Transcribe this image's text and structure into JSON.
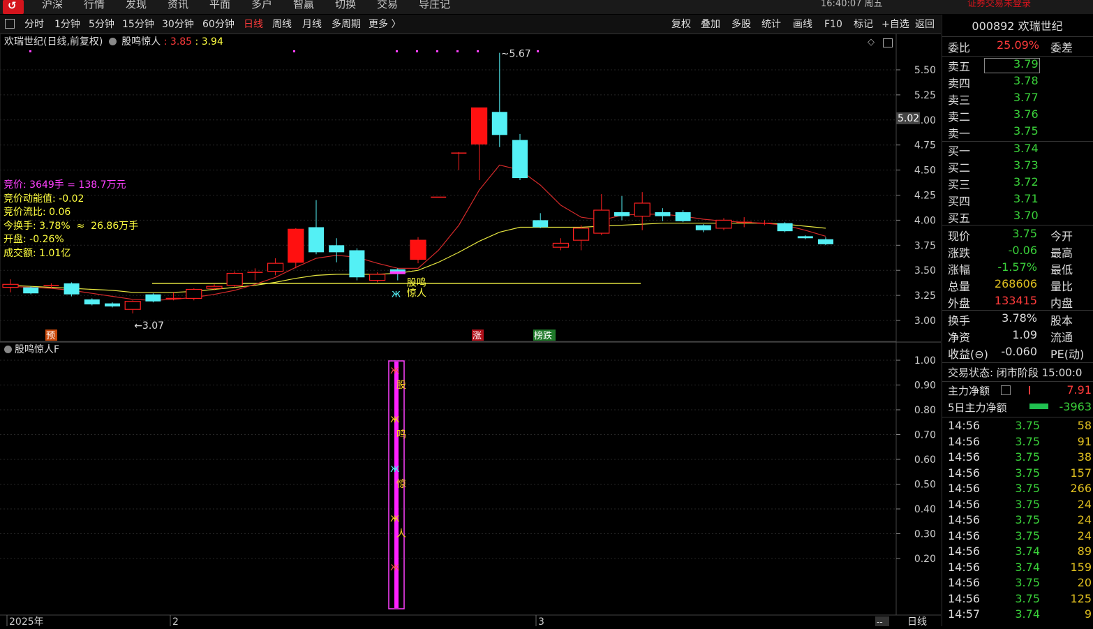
{
  "topbar": {
    "menu": [
      "沪深",
      "行情",
      "发现",
      "资讯",
      "平面",
      "多户",
      "智赢",
      "切换",
      "交易",
      "导庄记"
    ],
    "clock": "16:40:07 周五",
    "login": "证券交易未登录"
  },
  "toolbar": {
    "periods": [
      "分时",
      "1分钟",
      "5分钟",
      "15分钟",
      "30分钟",
      "60分钟",
      "日线",
      "周线",
      "月线",
      "多周期",
      "更多 〉"
    ],
    "active": "日线",
    "right": [
      "复权",
      "叠加",
      "多股",
      "统计",
      "画线",
      "F10",
      "标记",
      "+自选",
      "返回"
    ]
  },
  "main_chart": {
    "title": "欢瑞世纪(日线,前复权)",
    "indicator": "股鸣惊人",
    "val1": "3.85",
    "val2": "3.94",
    "high_label": "5.67",
    "low_label": "3.07",
    "right_price_tag": "5.02",
    "signal_text1": "股鸣",
    "signal_text2": "惊人",
    "badges": [
      {
        "text": "预",
        "color": "#c8480a"
      },
      {
        "text": "涨",
        "color": "#b0101a"
      },
      {
        "text": "榜跌",
        "color": "#1f7a2a"
      }
    ]
  },
  "info_lines": [
    {
      "text": "竞价: 3649手 = 138.7万元",
      "color": "#ff40ff"
    },
    {
      "text": "竞价动能值: -0.02",
      "color": "#ffff40"
    },
    {
      "text": "竞价流比: 0.06",
      "color": "#ffff40"
    },
    {
      "text": "今换手: 3.78%  ≈  26.86万手",
      "color": "#ffff40"
    },
    {
      "text": "开盘: -0.26%",
      "color": "#ffff40"
    },
    {
      "text": "成交额: 1.01亿",
      "color": "#ffff40"
    }
  ],
  "chart_data": {
    "type": "candlestick",
    "ylim": [
      2.9,
      5.75
    ],
    "yticks": [
      "5.50",
      "5.25",
      "5.00",
      "4.75",
      "4.50",
      "4.25",
      "4.00",
      "3.75",
      "3.50",
      "3.25",
      "3.00"
    ],
    "xlabels": [
      "2025年",
      "2",
      "3"
    ],
    "period": "日线",
    "candles": [
      {
        "o": 3.33,
        "c": 3.36,
        "h": 3.41,
        "l": 3.28
      },
      {
        "o": 3.33,
        "c": 3.27,
        "h": 3.34,
        "l": 3.26
      },
      {
        "o": 3.35,
        "c": 3.35,
        "h": 3.37,
        "l": 3.32
      },
      {
        "o": 3.37,
        "c": 3.26,
        "h": 3.38,
        "l": 3.24
      },
      {
        "o": 3.21,
        "c": 3.16,
        "h": 3.22,
        "l": 3.15
      },
      {
        "o": 3.17,
        "c": 3.14,
        "h": 3.18,
        "l": 3.13
      },
      {
        "o": 3.11,
        "c": 3.19,
        "h": 3.2,
        "l": 3.07
      },
      {
        "o": 3.26,
        "c": 3.19,
        "h": 3.27,
        "l": 3.18
      },
      {
        "o": 3.22,
        "c": 3.22,
        "h": 3.28,
        "l": 3.2
      },
      {
        "o": 3.22,
        "c": 3.31,
        "h": 3.32,
        "l": 3.2
      },
      {
        "o": 3.32,
        "c": 3.34,
        "h": 3.36,
        "l": 3.3
      },
      {
        "o": 3.35,
        "c": 3.47,
        "h": 3.49,
        "l": 3.33
      },
      {
        "o": 3.48,
        "c": 3.48,
        "h": 3.52,
        "l": 3.4
      },
      {
        "o": 3.49,
        "c": 3.57,
        "h": 3.62,
        "l": 3.45
      },
      {
        "o": 3.58,
        "c": 3.91,
        "h": 3.92,
        "l": 3.52
      },
      {
        "o": 3.93,
        "c": 3.68,
        "h": 4.2,
        "l": 3.66
      },
      {
        "o": 3.75,
        "c": 3.68,
        "h": 3.82,
        "l": 3.58
      },
      {
        "o": 3.7,
        "c": 3.43,
        "h": 3.72,
        "l": 3.4
      },
      {
        "o": 3.4,
        "c": 3.46,
        "h": 3.48,
        "l": 3.38
      },
      {
        "o": 3.51,
        "c": 3.47,
        "h": 3.52,
        "l": 3.4
      },
      {
        "o": 3.61,
        "c": 3.8,
        "h": 3.83,
        "l": 3.57
      },
      {
        "o": 4.23,
        "c": 4.23,
        "h": 4.23,
        "l": 4.23
      },
      {
        "o": 4.67,
        "c": 4.67,
        "h": 4.68,
        "l": 4.5
      },
      {
        "o": 4.76,
        "c": 5.12,
        "h": 5.12,
        "l": 4.4
      },
      {
        "o": 5.08,
        "c": 4.85,
        "h": 5.67,
        "l": 4.73
      },
      {
        "o": 4.8,
        "c": 4.42,
        "h": 4.86,
        "l": 4.4
      },
      {
        "o": 4.0,
        "c": 3.93,
        "h": 4.07,
        "l": 3.92
      },
      {
        "o": 3.73,
        "c": 3.77,
        "h": 3.82,
        "l": 3.7
      },
      {
        "o": 3.8,
        "c": 3.92,
        "h": 3.95,
        "l": 3.7
      },
      {
        "o": 3.87,
        "c": 4.1,
        "h": 4.26,
        "l": 3.85
      },
      {
        "o": 4.08,
        "c": 4.04,
        "h": 4.24,
        "l": 4.0
      },
      {
        "o": 4.04,
        "c": 4.17,
        "h": 4.28,
        "l": 3.9
      },
      {
        "o": 4.08,
        "c": 4.04,
        "h": 4.12,
        "l": 3.99
      },
      {
        "o": 4.08,
        "c": 3.99,
        "h": 4.1,
        "l": 3.98
      },
      {
        "o": 3.95,
        "c": 3.9,
        "h": 3.96,
        "l": 3.88
      },
      {
        "o": 3.92,
        "c": 4.0,
        "h": 4.02,
        "l": 3.9
      },
      {
        "o": 3.98,
        "c": 3.98,
        "h": 4.03,
        "l": 3.93
      },
      {
        "o": 3.97,
        "c": 3.97,
        "h": 4.0,
        "l": 3.95
      },
      {
        "o": 3.97,
        "c": 3.89,
        "h": 3.98,
        "l": 3.88
      },
      {
        "o": 3.84,
        "c": 3.82,
        "h": 3.85,
        "l": 3.81
      },
      {
        "o": 3.81,
        "c": 3.76,
        "h": 3.83,
        "l": 3.75
      }
    ],
    "ma_red": [
      3.34,
      3.33,
      3.32,
      3.3,
      3.27,
      3.24,
      3.21,
      3.2,
      3.21,
      3.23,
      3.26,
      3.3,
      3.36,
      3.43,
      3.53,
      3.62,
      3.65,
      3.63,
      3.57,
      3.52,
      3.52,
      3.7,
      3.95,
      4.3,
      4.55,
      4.5,
      4.35,
      4.15,
      4.03,
      4.0,
      4.05,
      4.06,
      4.06,
      4.04,
      4.01,
      3.99,
      3.98,
      3.97,
      3.95,
      3.9,
      3.84
    ],
    "ma_yellow": [
      3.35,
      3.34,
      3.33,
      3.32,
      3.31,
      3.3,
      3.28,
      3.28,
      3.28,
      3.29,
      3.31,
      3.33,
      3.35,
      3.38,
      3.42,
      3.45,
      3.46,
      3.46,
      3.46,
      3.47,
      3.5,
      3.58,
      3.68,
      3.79,
      3.88,
      3.93,
      3.93,
      3.93,
      3.93,
      3.94,
      3.95,
      3.96,
      3.97,
      3.97,
      3.97,
      3.97,
      3.97,
      3.97,
      3.96,
      3.94,
      3.92
    ],
    "support_level": 3.37
  },
  "sub_chart": {
    "title": "股鸣惊人F",
    "yticks": [
      "1.00",
      "0.90",
      "0.80",
      "0.70",
      "0.60",
      "0.50",
      "0.40",
      "0.30",
      "0.20"
    ],
    "chars": [
      "股",
      "鸣",
      "惊",
      "人"
    ]
  },
  "right_panel": {
    "stock": "000892 欢瑞世纪",
    "weibi_label": "委比",
    "weibi_value": "25.09%",
    "weicha_label": "委差",
    "sells": [
      {
        "label": "卖五",
        "price": "3.79"
      },
      {
        "label": "卖四",
        "price": "3.78"
      },
      {
        "label": "卖三",
        "price": "3.77"
      },
      {
        "label": "卖二",
        "price": "3.76"
      },
      {
        "label": "卖一",
        "price": "3.75"
      }
    ],
    "buys": [
      {
        "label": "买一",
        "price": "3.74"
      },
      {
        "label": "买二",
        "price": "3.73"
      },
      {
        "label": "买三",
        "price": "3.72"
      },
      {
        "label": "买四",
        "price": "3.71"
      },
      {
        "label": "买五",
        "price": "3.70"
      }
    ],
    "quote": [
      {
        "l": "现价",
        "v": "3.75",
        "vc": "#3ad13a",
        "r": "今开"
      },
      {
        "l": "涨跌",
        "v": "-0.06",
        "vc": "#3ad13a",
        "r": "最高"
      },
      {
        "l": "涨幅",
        "v": "-1.57%",
        "vc": "#3ad13a",
        "r": "最低"
      },
      {
        "l": "总量",
        "v": "268606",
        "vc": "#e0c020",
        "r": "量比"
      },
      {
        "l": "外盘",
        "v": "133415",
        "vc": "#ff3b3b",
        "r": "内盘"
      }
    ],
    "quote2": [
      {
        "l": "换手",
        "v": "3.78%",
        "vc": "#ddd",
        "r": "股本"
      },
      {
        "l": "净资",
        "v": "1.09",
        "vc": "#ddd",
        "r": "流通"
      },
      {
        "l": "收益(⊖)",
        "v": "-0.060",
        "vc": "#ddd",
        "r": "PE(动)"
      }
    ],
    "trade_status": "交易状态: 闭市阶段 15:00:0",
    "main_flow_label": "主力净额",
    "main_flow_value": "7.91",
    "flow5_label": "5日主力净额",
    "flow5_value": "-3963",
    "ticks": [
      {
        "t": "14:56",
        "p": "3.75",
        "v": "58"
      },
      {
        "t": "14:56",
        "p": "3.75",
        "v": "91"
      },
      {
        "t": "14:56",
        "p": "3.75",
        "v": "38"
      },
      {
        "t": "14:56",
        "p": "3.75",
        "v": "157"
      },
      {
        "t": "14:56",
        "p": "3.75",
        "v": "266"
      },
      {
        "t": "14:56",
        "p": "3.75",
        "v": "24"
      },
      {
        "t": "14:56",
        "p": "3.75",
        "v": "24"
      },
      {
        "t": "14:56",
        "p": "3.75",
        "v": "24"
      },
      {
        "t": "14:56",
        "p": "3.74",
        "v": "89"
      },
      {
        "t": "14:56",
        "p": "3.74",
        "v": "159"
      },
      {
        "t": "14:56",
        "p": "3.75",
        "v": "20"
      },
      {
        "t": "14:56",
        "p": "3.75",
        "v": "125"
      },
      {
        "t": "14:57",
        "p": "3.74",
        "v": "9"
      }
    ],
    "bottom_period": "日线",
    "bottom_dash": "--"
  }
}
